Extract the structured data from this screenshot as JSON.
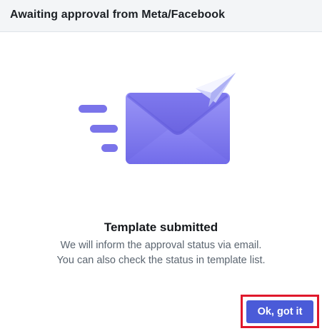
{
  "dialog": {
    "title": "Awaiting approval from Meta/Facebook"
  },
  "message": {
    "title": "Template submitted",
    "line1": "We will inform the approval status via email.",
    "line2": "You can also check the status in template list."
  },
  "actions": {
    "ok_label": "Ok, got it"
  },
  "colors": {
    "accent": "#4a5bd8",
    "envelope": "#8a86f2",
    "highlight": "#e0182b"
  }
}
